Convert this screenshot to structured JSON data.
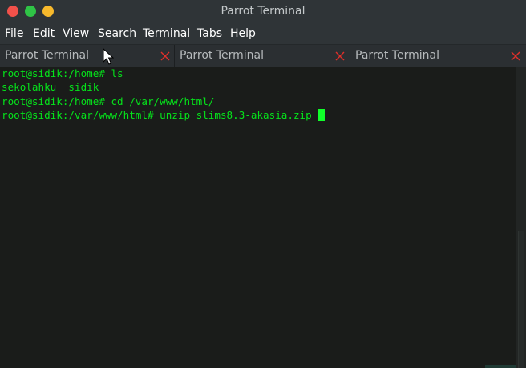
{
  "window": {
    "title": "Parrot Terminal",
    "controls": {
      "close_color": "#f2514a",
      "maximize_color": "#2fc446",
      "minimize_color": "#f7b92c"
    }
  },
  "menu": {
    "items": [
      "File",
      "Edit",
      "View",
      "Search",
      "Terminal",
      "Tabs",
      "Help"
    ]
  },
  "tabs": [
    {
      "label": "Parrot Terminal",
      "close_icon": "close-x-icon"
    },
    {
      "label": "Parrot Terminal",
      "close_icon": "close-x-icon"
    },
    {
      "label": "Parrot Terminal",
      "close_icon": "close-x-icon"
    }
  ],
  "terminal": {
    "text_color": "#05e21a",
    "background": "#1a1c1a",
    "lines": [
      "root@sidik:/home# ls",
      "sekolahku  sidik",
      "root@sidik:/home# cd /var/www/html/",
      "root@sidik:/var/www/html# unzip slims8.3-akasia.zip"
    ]
  },
  "colors": {
    "tab_close": "#e0302a",
    "chrome": "#2f3437"
  }
}
